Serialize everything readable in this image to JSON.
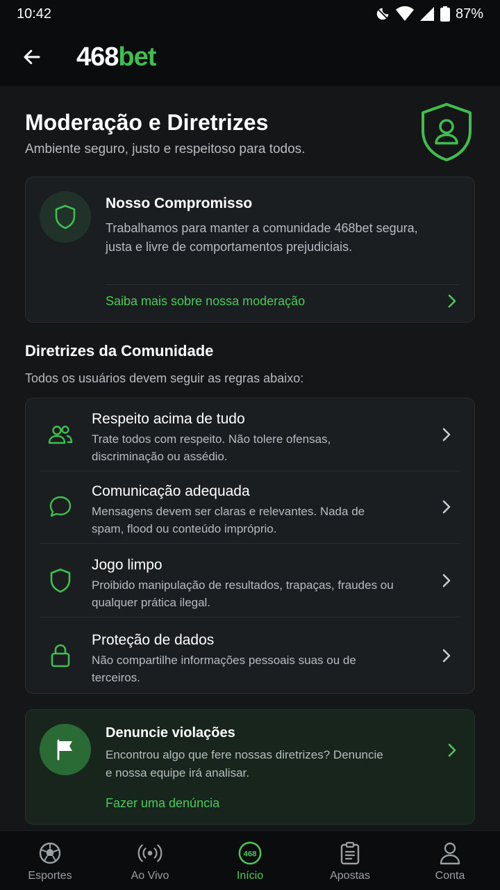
{
  "status": {
    "time": "10:42",
    "battery": "87%"
  },
  "header": {
    "logo_num": "468",
    "logo_bet": "bet"
  },
  "hero": {
    "title": "Moderação e Diretrizes",
    "subtitle": "Ambiente seguro, justo e respeitoso para todos."
  },
  "commitment": {
    "title": "Nosso Compromisso",
    "text": "Trabalhamos para manter a comunidade 468bet segura, justa e livre de comportamentos prejudiciais.",
    "link": "Saiba mais sobre nossa moderação"
  },
  "guidelines": {
    "title": "Diretrizes da Comunidade",
    "subtitle": "Todos os usuários devem seguir as regras abaixo:",
    "items": [
      {
        "icon": "users-icon",
        "title": "Respeito acima de tudo",
        "desc": "Trate todos com respeito. Não tolere ofensas, discriminação ou assédio."
      },
      {
        "icon": "chat-bubble-icon",
        "title": "Comunicação adequada",
        "desc": "Mensagens devem ser claras e relevantes. Nada de spam, flood ou conteúdo impróprio."
      },
      {
        "icon": "shield-icon",
        "title": "Jogo limpo",
        "desc": "Proibido manipulação de resultados, trapaças, fraudes ou qualquer prática ilegal."
      },
      {
        "icon": "lock-icon",
        "title": "Proteção de dados",
        "desc": "Não compartilhe informações pessoais suas ou de terceiros."
      }
    ]
  },
  "report": {
    "title": "Denuncie violações",
    "text": "Encontrou algo que fere nossas diretrizes? Denuncie e nossa equipe irá analisar.",
    "link": "Fazer uma denúncia"
  },
  "nav": {
    "items": [
      {
        "icon": "soccer-ball-icon",
        "label": "Esportes",
        "active": false
      },
      {
        "icon": "live-broadcast-icon",
        "label": "Ao Vivo",
        "active": false
      },
      {
        "icon": "home-logo-icon",
        "label": "Início",
        "active": true,
        "badge": "468"
      },
      {
        "icon": "clipboard-icon",
        "label": "Apostas",
        "active": false
      },
      {
        "icon": "user-icon",
        "label": "Conta",
        "active": false
      }
    ]
  },
  "colors": {
    "accent": "#4cc95a",
    "background": "#141618",
    "card": "#1b1e20"
  }
}
